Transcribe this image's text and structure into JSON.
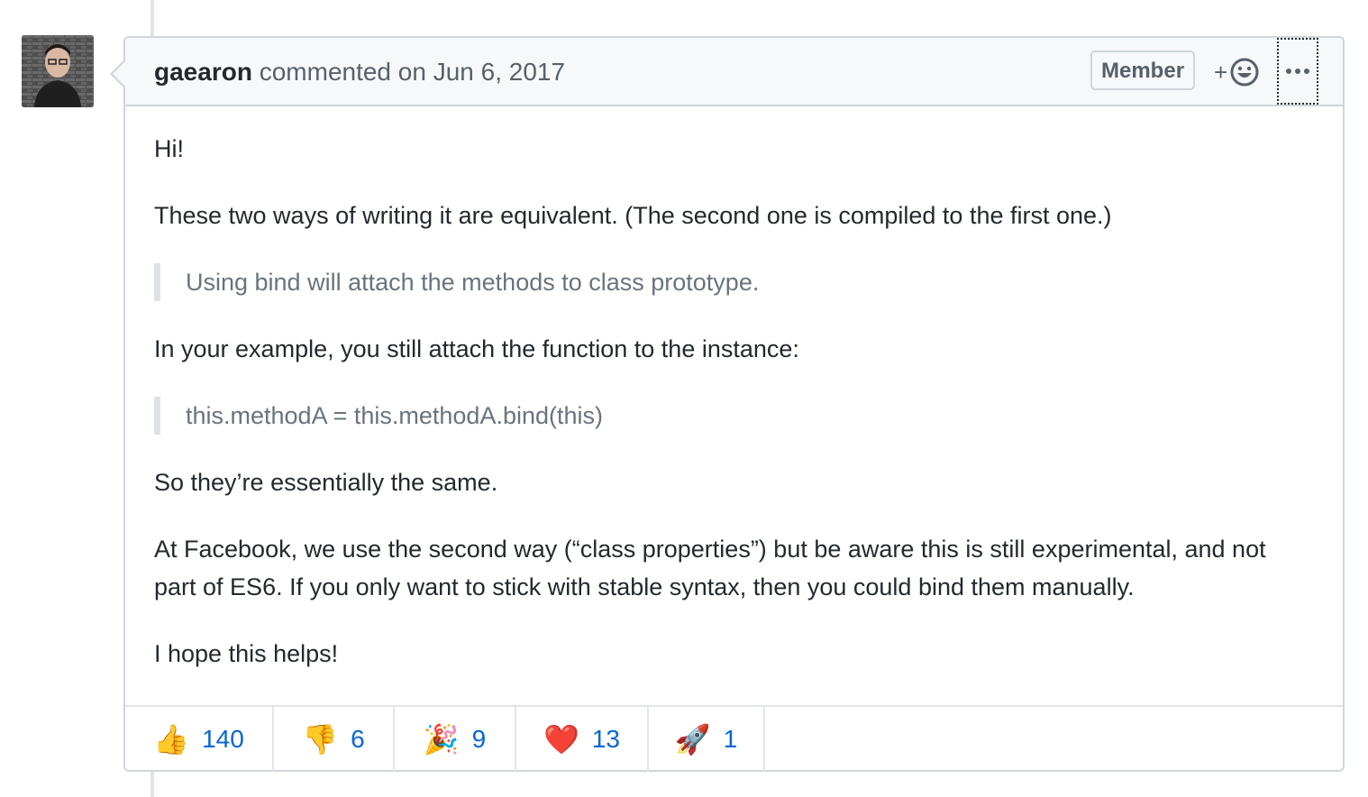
{
  "comment": {
    "author": "gaearon",
    "meta": "commented on Jun 6, 2017",
    "badge": "Member",
    "reaction_picker_plus": "+",
    "body": {
      "p1": "Hi!",
      "p2": "These two ways of writing it are equivalent. (The second one is compiled to the first one.)",
      "quote1": "Using bind will attach the methods to class prototype.",
      "p3": "In your example, you still attach the function to the instance:",
      "quote2": "this.methodA = this.methodA.bind(this)",
      "p4": "So they’re essentially the same.",
      "p5": "At Facebook, we use the second way (“class properties”) but be aware this is still experimental, and not part of ES6. If you only want to stick with stable syntax, then you could bind them manually.",
      "p6": "I hope this helps!"
    },
    "reactions": [
      {
        "emoji": "👍",
        "icon": "thumbs-up-icon",
        "count": "140"
      },
      {
        "emoji": "👎",
        "icon": "thumbs-down-icon",
        "count": "6"
      },
      {
        "emoji": "🎉",
        "icon": "tada-icon",
        "count": "9"
      },
      {
        "emoji": "❤️",
        "icon": "heart-icon",
        "count": "13"
      },
      {
        "emoji": "🚀",
        "icon": "rocket-icon",
        "count": "1"
      }
    ]
  },
  "colors": {
    "link": "#0366d6",
    "muted": "#586069",
    "border": "#d1d5da",
    "header_bg": "#f6f8fa"
  }
}
